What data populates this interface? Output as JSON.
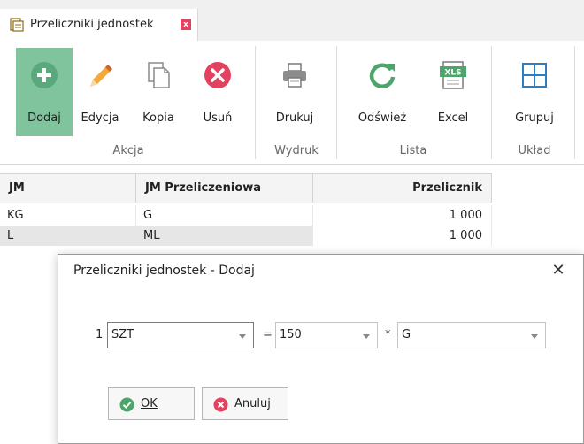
{
  "tab": {
    "title": "Przeliczniki jednostek",
    "close": "x"
  },
  "ribbon": {
    "buttons": [
      {
        "label": "Dodaj",
        "icon": "plus-circle-icon"
      },
      {
        "label": "Edycja",
        "icon": "pencil-icon"
      },
      {
        "label": "Kopia",
        "icon": "copy-icon"
      },
      {
        "label": "Usuń",
        "icon": "delete-icon"
      },
      {
        "label": "Drukuj",
        "icon": "printer-icon"
      },
      {
        "label": "Odśwież",
        "icon": "refresh-icon"
      },
      {
        "label": "Excel",
        "icon": "excel-icon"
      },
      {
        "label": "Grupuj",
        "icon": "group-icon"
      }
    ],
    "groups": [
      "Akcja",
      "Wydruk",
      "Lista",
      "Układ"
    ]
  },
  "grid": {
    "columns": [
      "JM",
      "JM Przeliczeniowa",
      "Przelicznik"
    ],
    "rows": [
      {
        "jm": "KG",
        "jm_przel": "G",
        "przelicznik": "1 000"
      },
      {
        "jm": "L",
        "jm_przel": "ML",
        "przelicznik": "1 000"
      }
    ]
  },
  "dialog": {
    "title": "Przeliczniki jednostek - Dodaj",
    "close": "✕",
    "row_number": "1",
    "unit_value": "SZT",
    "equals": "=",
    "factor_value": "150",
    "times": "*",
    "target_unit_value": "G",
    "ok_label": "OK",
    "cancel_label": "Anuluj"
  },
  "colors": {
    "accent_green": "#7fc49c",
    "delete_red": "#e2425f",
    "refresh_green": "#4ca56a"
  }
}
